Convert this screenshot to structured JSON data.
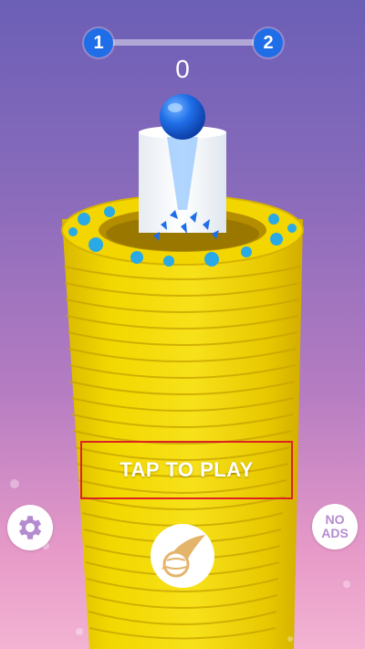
{
  "level": {
    "current": "1",
    "next": "2",
    "progress": 0
  },
  "score": "0",
  "play_prompt": "TAP TO PLAY",
  "buttons": {
    "settings_icon": "gear-icon",
    "no_ads_line1": "NO",
    "no_ads_line2": "ADS",
    "ball_select_icon": "ball-skin-icon"
  },
  "colors": {
    "accent_blue": "#1f6ee8",
    "tower_yellow": "#f0d400",
    "splash_blue": "#29a9e6",
    "frame_red": "#dd2222"
  }
}
